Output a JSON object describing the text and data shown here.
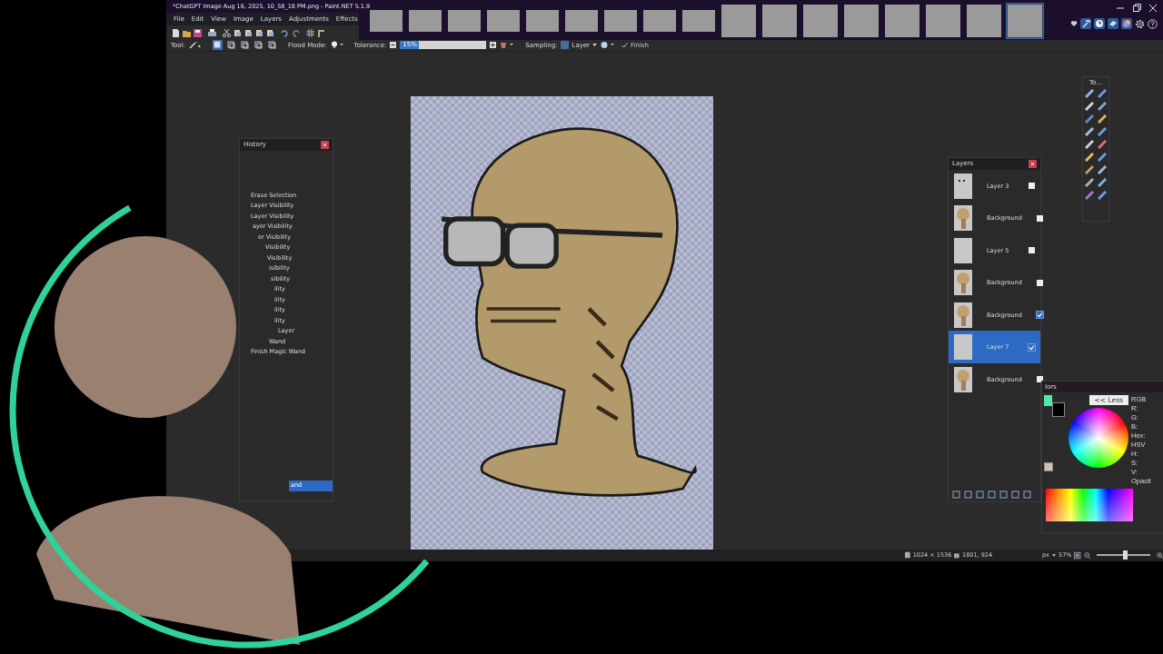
{
  "window": {
    "title": "*ChatGPT Image Aug 16, 2025, 10_58_18 PM.png - Paint.NET 5.1.9"
  },
  "menu": [
    "File",
    "Edit",
    "View",
    "Image",
    "Layers",
    "Adjustments",
    "Effects"
  ],
  "image_tabs": [
    {
      "selected": false
    },
    {
      "selected": false
    },
    {
      "selected": false
    },
    {
      "selected": false
    },
    {
      "selected": false
    },
    {
      "selected": false
    },
    {
      "selected": false
    },
    {
      "selected": false
    },
    {
      "selected": false
    },
    {
      "selected": false
    },
    {
      "selected": false
    },
    {
      "selected": false
    },
    {
      "selected": false
    },
    {
      "selected": false
    },
    {
      "selected": false
    },
    {
      "selected": false
    },
    {
      "selected": true
    }
  ],
  "tool_options": {
    "tool_label": "Tool:",
    "flood_mode_label": "Flood Mode:",
    "tolerance_label": "Tolerance:",
    "tolerance": {
      "reading": "15%",
      "level": 0.15
    },
    "sampling_label": "Sampling:",
    "sampling_value": "Layer",
    "finish": "Finish"
  },
  "tools_panel": {
    "title": "To..."
  },
  "history": {
    "title": "History",
    "items": [
      {
        "label": "Erase Selection",
        "selected": false
      },
      {
        "label": "Layer Visibility",
        "selected": false
      },
      {
        "label": "Layer Visibility",
        "selected": false
      },
      {
        "label": "ayer Visibility",
        "selected": false
      },
      {
        "label": "er Visibility",
        "selected": false
      },
      {
        "label": "Visibility",
        "selected": false
      },
      {
        "label": "Visibility",
        "selected": false
      },
      {
        "label": "isibility",
        "selected": false
      },
      {
        "label": "sibility",
        "selected": false
      },
      {
        "label": "ility",
        "selected": false
      },
      {
        "label": "ility",
        "selected": false
      },
      {
        "label": "ility",
        "selected": false
      },
      {
        "label": "ility",
        "selected": false
      },
      {
        "label": "Layer",
        "selected": false
      },
      {
        "label": "Wand",
        "selected": false
      },
      {
        "label": "Finish Magic Wand",
        "selected": false
      },
      {
        "label": "and",
        "selected": true
      }
    ]
  },
  "layers": {
    "title": "Layers",
    "items": [
      {
        "name": "Layer 3",
        "kind": "marks",
        "visible": false,
        "selected": false
      },
      {
        "name": "Background",
        "kind": "skull",
        "visible": false,
        "selected": false
      },
      {
        "name": "Layer 5",
        "kind": "blank",
        "visible": false,
        "selected": false
      },
      {
        "name": "Background",
        "kind": "skull",
        "visible": false,
        "selected": false
      },
      {
        "name": "Background",
        "kind": "skull",
        "visible": true,
        "selected": false
      },
      {
        "name": "Layer 7",
        "kind": "blank",
        "visible": true,
        "selected": true
      },
      {
        "name": "Background",
        "kind": "skull",
        "visible": false,
        "selected": false
      }
    ]
  },
  "colors": {
    "title": "lors",
    "less_button": "<< Less",
    "labels": [
      "RGB",
      "R:",
      "G:",
      "B:",
      "Hex:",
      "HSV",
      "H:",
      "S:",
      "V:",
      "Opacit"
    ]
  },
  "status_bar": {
    "image_size": "1024 × 1536",
    "cursor_position": "1801, 924",
    "units": "px",
    "zoom": "57%",
    "zoom_slider": {
      "level": 0.55
    }
  }
}
